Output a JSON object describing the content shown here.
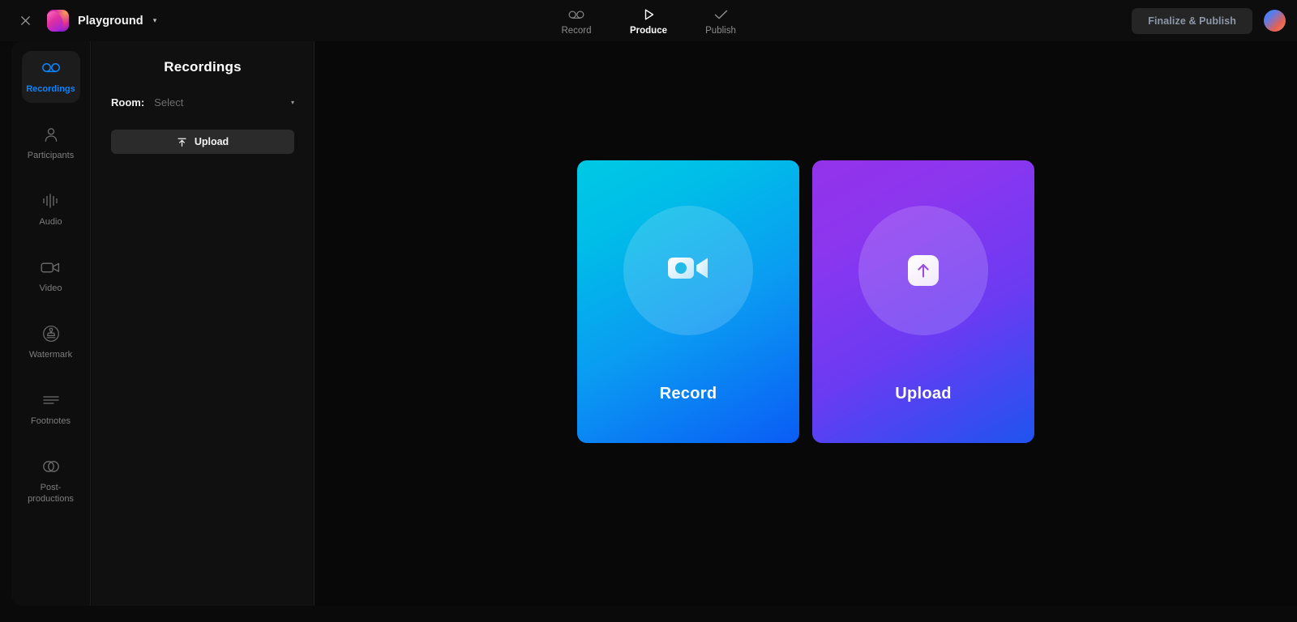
{
  "topbar": {
    "close_icon": "close-icon",
    "logo_icon": "app-logo-icon",
    "project_name": "Playground",
    "project_caret": "▾",
    "nav": [
      {
        "label": "Record",
        "icon": "tape-reel-icon",
        "active": false
      },
      {
        "label": "Produce",
        "icon": "play-triangle-icon",
        "active": true
      },
      {
        "label": "Publish",
        "icon": "check-icon",
        "active": false
      }
    ],
    "finalize_label": "Finalize & Publish",
    "avatar_icon": "user-avatar"
  },
  "sidebar": {
    "items": [
      {
        "label": "Recordings",
        "icon": "tape-reel-icon",
        "active": true
      },
      {
        "label": "Participants",
        "icon": "person-icon",
        "active": false
      },
      {
        "label": "Audio",
        "icon": "waveform-icon",
        "active": false
      },
      {
        "label": "Video",
        "icon": "video-camera-icon",
        "active": false
      },
      {
        "label": "Watermark",
        "icon": "stamp-circle-icon",
        "active": false
      },
      {
        "label": "Footnotes",
        "icon": "lines-icon",
        "active": false
      },
      {
        "label": "Post-productions",
        "icon": "overlapping-circles-icon",
        "active": false
      }
    ]
  },
  "panel": {
    "title": "Recordings",
    "room_label": "Room:",
    "room_placeholder": "Select",
    "room_value": "",
    "room_caret": "▾",
    "upload_button_label": "Upload",
    "upload_button_icon": "upload-arrow-icon"
  },
  "stage": {
    "cards": [
      {
        "label": "Record",
        "icon": "video-camera-icon",
        "gradient_from": "#00c9e4",
        "gradient_to": "#0a5cf5"
      },
      {
        "label": "Upload",
        "icon": "upload-arrow-icon",
        "gradient_from": "#9333ea",
        "gradient_to": "#1f54f0"
      }
    ]
  },
  "colors": {
    "accent_blue": "#0a84ff",
    "background": "#0a0a0a",
    "panel": "#101010",
    "stage": "#080808"
  }
}
